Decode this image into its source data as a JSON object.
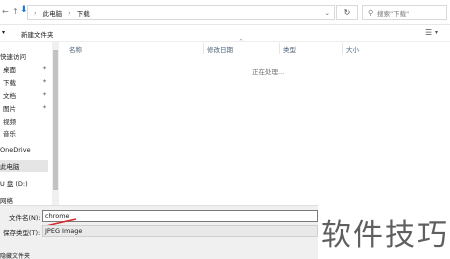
{
  "address": {
    "path_root": "此电脑",
    "path_folder": "下载",
    "search_placeholder": "搜索\"下载\""
  },
  "toolbar": {
    "new_folder": "新建文件夹"
  },
  "sidebar": {
    "quick_access": "快速访问",
    "items": [
      {
        "label": "桌面",
        "pinned": true
      },
      {
        "label": "下载",
        "pinned": true
      },
      {
        "label": "文档",
        "pinned": true
      },
      {
        "label": "图片",
        "pinned": true
      },
      {
        "label": "视频",
        "pinned": false
      },
      {
        "label": "音乐",
        "pinned": false
      }
    ],
    "onedrive": "OneDrive",
    "this_pc": "此电脑",
    "drive": "U 盘 (D:)",
    "network": "网络"
  },
  "columns": [
    "名称",
    "修改日期",
    "类型",
    "大小"
  ],
  "status": {
    "processing": "正在处理..."
  },
  "form": {
    "filename_label": "文件名(N):",
    "filename_value": "chrome",
    "type_label": "保存类型(T):",
    "type_value": "JPEG Image",
    "hide_folders": "隐藏文件夹"
  },
  "watermark": "软件技巧",
  "colors": {
    "underline": "#d9272e",
    "selected_bg": "#e5e5e5",
    "nav_arrow": "#1b73d3"
  }
}
